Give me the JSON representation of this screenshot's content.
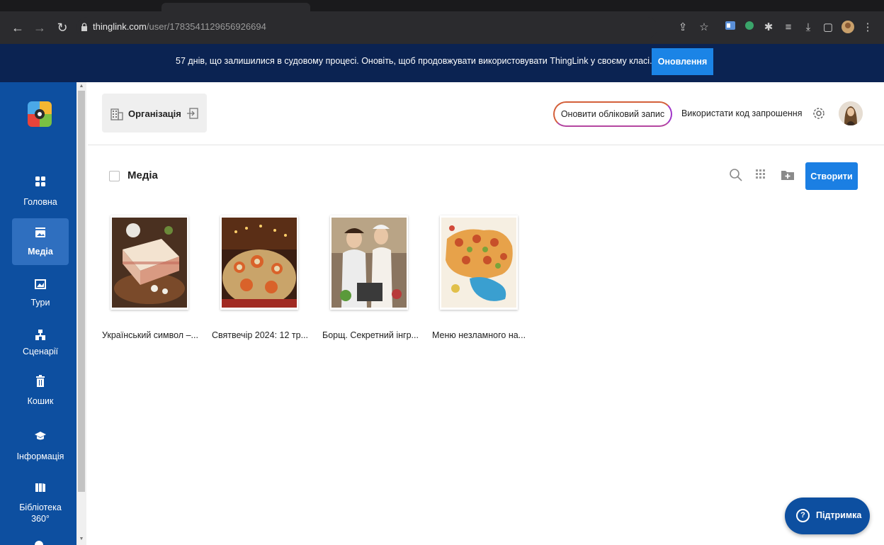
{
  "browser": {
    "url_domain": "thinglink.com",
    "url_path": "/user/1783541129656926694",
    "icons": [
      "back-icon",
      "forward-icon",
      "reload-icon",
      "lock-icon",
      "share-icon",
      "star-icon",
      "extension-icons",
      "menu-icon"
    ]
  },
  "banner": {
    "text": "57 днів, що залишилися в судовому процесі. Оновіть, щоб продовжувати використовувати ThingLink у своєму класі.",
    "button": "Оновлення"
  },
  "sidebar": {
    "items": [
      {
        "label": "Головна",
        "icon": "home-grid-icon"
      },
      {
        "label": "Медіа",
        "icon": "media-icon"
      },
      {
        "label": "Тури",
        "icon": "tours-icon"
      },
      {
        "label": "Сценарії",
        "icon": "scenarios-icon"
      },
      {
        "label": "Кошик",
        "icon": "trash-icon"
      },
      {
        "label": "Інформація",
        "icon": "info-cap-icon"
      },
      {
        "label1": "Бібліотека",
        "label2": "360°",
        "icon": "library-icon"
      }
    ]
  },
  "header": {
    "org_label": "Організація",
    "upgrade_button": "Оновити обліковий запис",
    "invite_link": "Використати код запрошення"
  },
  "media": {
    "title": "Медіа",
    "create_button": "Створити",
    "items": [
      {
        "title": "Український символ –..."
      },
      {
        "title": "Святвечір 2024: 12 тр..."
      },
      {
        "title": "Борщ. Секретний інгр..."
      },
      {
        "title": "Меню незламного на..."
      }
    ]
  },
  "support": {
    "label": "Підтримка"
  },
  "colors": {
    "sidebar": "#0d4fa0",
    "banner": "#0b2352",
    "primary_button": "#1b7fe3"
  }
}
